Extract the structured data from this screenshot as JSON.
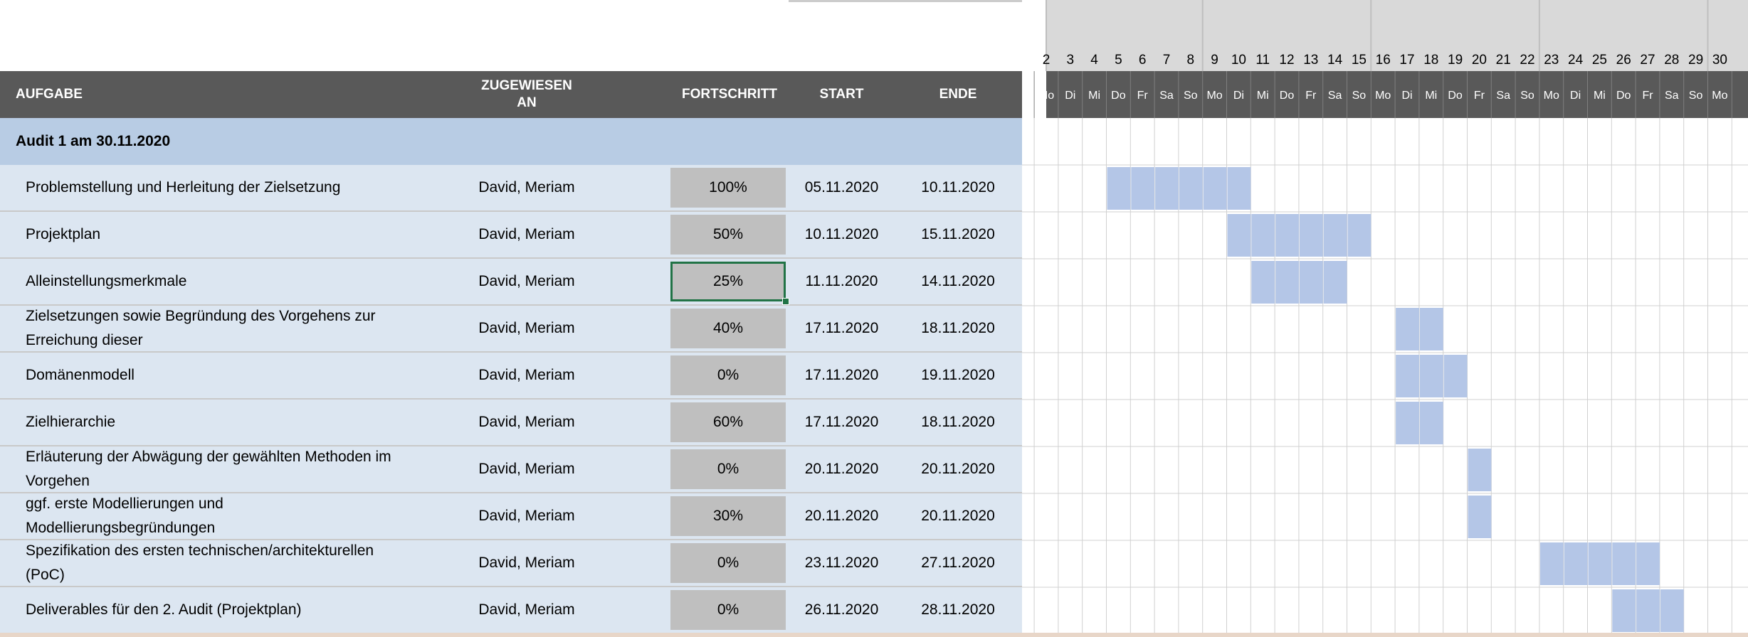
{
  "headers": {
    "aufgabe": "AUFGABE",
    "zugewiesen_line1": "ZUGEWIESEN",
    "zugewiesen_line2": "AN",
    "fortschritt": "FORTSCHRITT",
    "start": "START",
    "ende": "ENDE"
  },
  "section": {
    "title": "Audit 1 am 30.11.2020"
  },
  "timeline": {
    "days": [
      {
        "num": "2",
        "name": "Mo"
      },
      {
        "num": "3",
        "name": "Di"
      },
      {
        "num": "4",
        "name": "Mi"
      },
      {
        "num": "5",
        "name": "Do"
      },
      {
        "num": "6",
        "name": "Fr"
      },
      {
        "num": "7",
        "name": "Sa"
      },
      {
        "num": "8",
        "name": "So"
      },
      {
        "num": "9",
        "name": "Mo"
      },
      {
        "num": "10",
        "name": "Di"
      },
      {
        "num": "11",
        "name": "Mi"
      },
      {
        "num": "12",
        "name": "Do"
      },
      {
        "num": "13",
        "name": "Fr"
      },
      {
        "num": "14",
        "name": "Sa"
      },
      {
        "num": "15",
        "name": "So"
      },
      {
        "num": "16",
        "name": "Mo"
      },
      {
        "num": "17",
        "name": "Di"
      },
      {
        "num": "18",
        "name": "Mi"
      },
      {
        "num": "19",
        "name": "Do"
      },
      {
        "num": "20",
        "name": "Fr"
      },
      {
        "num": "21",
        "name": "Sa"
      },
      {
        "num": "22",
        "name": "So"
      },
      {
        "num": "23",
        "name": "Mo"
      },
      {
        "num": "24",
        "name": "Di"
      },
      {
        "num": "25",
        "name": "Mi"
      },
      {
        "num": "26",
        "name": "Do"
      },
      {
        "num": "27",
        "name": "Fr"
      },
      {
        "num": "28",
        "name": "Sa"
      },
      {
        "num": "29",
        "name": "So"
      },
      {
        "num": "30",
        "name": "Mo"
      }
    ]
  },
  "tasks": [
    {
      "name": "Problemstellung und Herleitung der Zielsetzung",
      "assignee": "David, Meriam",
      "progress": "100%",
      "start": "05.11.2020",
      "end": "10.11.2020",
      "bar_start_day": 5,
      "bar_end_day": 10
    },
    {
      "name": "Projektplan",
      "assignee": "David, Meriam",
      "progress": "50%",
      "start": "10.11.2020",
      "end": "15.11.2020",
      "bar_start_day": 10,
      "bar_end_day": 15
    },
    {
      "name": "Alleinstellungsmerkmale",
      "assignee": "David, Meriam",
      "progress": "25%",
      "start": "11.11.2020",
      "end": "14.11.2020",
      "bar_start_day": 11,
      "bar_end_day": 14
    },
    {
      "name": "Zielsetzungen sowie Begründung des Vorgehens zur Erreichung dieser",
      "assignee": "David, Meriam",
      "progress": "40%",
      "start": "17.11.2020",
      "end": "18.11.2020",
      "bar_start_day": 17,
      "bar_end_day": 18
    },
    {
      "name": "Domänenmodell",
      "assignee": "David, Meriam",
      "progress": "0%",
      "start": "17.11.2020",
      "end": "19.11.2020",
      "bar_start_day": 17,
      "bar_end_day": 19
    },
    {
      "name": "Zielhierarchie",
      "assignee": "David, Meriam",
      "progress": "60%",
      "start": "17.11.2020",
      "end": "18.11.2020",
      "bar_start_day": 17,
      "bar_end_day": 18
    },
    {
      "name": "Erläuterung der Abwägung der gewählten Methoden im Vorgehen",
      "assignee": "David, Meriam",
      "progress": "0%",
      "start": "20.11.2020",
      "end": "20.11.2020",
      "bar_start_day": 20,
      "bar_end_day": 20
    },
    {
      "name": "ggf. erste Modellierungen und Modellierungsbegründungen",
      "assignee": "David, Meriam",
      "progress": "30%",
      "start": "20.11.2020",
      "end": "20.11.2020",
      "bar_start_day": 20,
      "bar_end_day": 20
    },
    {
      "name": "Spezifikation des ersten technischen/architekturellen (PoC)",
      "assignee": "David, Meriam",
      "progress": "0%",
      "start": "23.11.2020",
      "end": "27.11.2020",
      "bar_start_day": 23,
      "bar_end_day": 27
    },
    {
      "name": "Deliverables für den 2. Audit (Projektplan)",
      "assignee": "David, Meriam",
      "progress": "0%",
      "start": "26.11.2020",
      "end": "28.11.2020",
      "bar_start_day": 26,
      "bar_end_day": 28
    }
  ],
  "selected_task_index": 2,
  "colors": {
    "header_bg": "#595959",
    "section_bg": "#b8cce4",
    "row_bg": "#dce6f1",
    "progress_bg": "#bfbfbf",
    "bar_fill": "#b4c6e7",
    "week_header_bg": "#d9d9d9",
    "selection_border": "#217346"
  }
}
